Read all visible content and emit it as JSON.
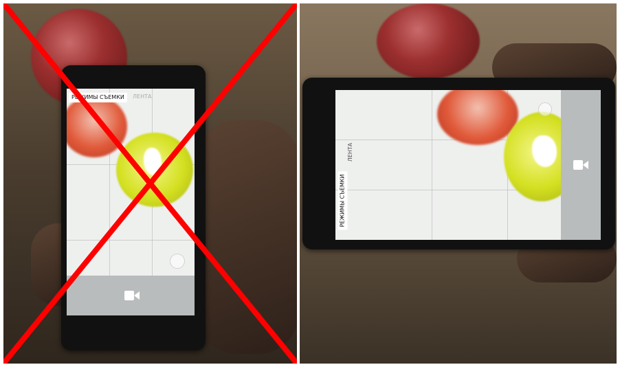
{
  "left_photo": {
    "screen_tabs": {
      "active": "РЕЖИМЫ СЪЕМКИ",
      "inactive": "ЛЕНТА"
    },
    "camera_mode_icon": "video-camera-icon",
    "more_icon": "more-dots-icon",
    "cross_out_color": "#ff0000",
    "marked_as": "incorrect"
  },
  "right_photo": {
    "screen_tabs": {
      "active": "РЕЖИМЫ СЪЕМКИ",
      "inactive": "ЛЕНТА"
    },
    "camera_mode_icon": "video-camera-icon",
    "more_icon": "more-dots-icon"
  },
  "colors": {
    "cross": "#ff0000",
    "red_ornament": "#e05a3a",
    "yellow_ball": "#d4e021",
    "screen": "#eef0ee"
  }
}
